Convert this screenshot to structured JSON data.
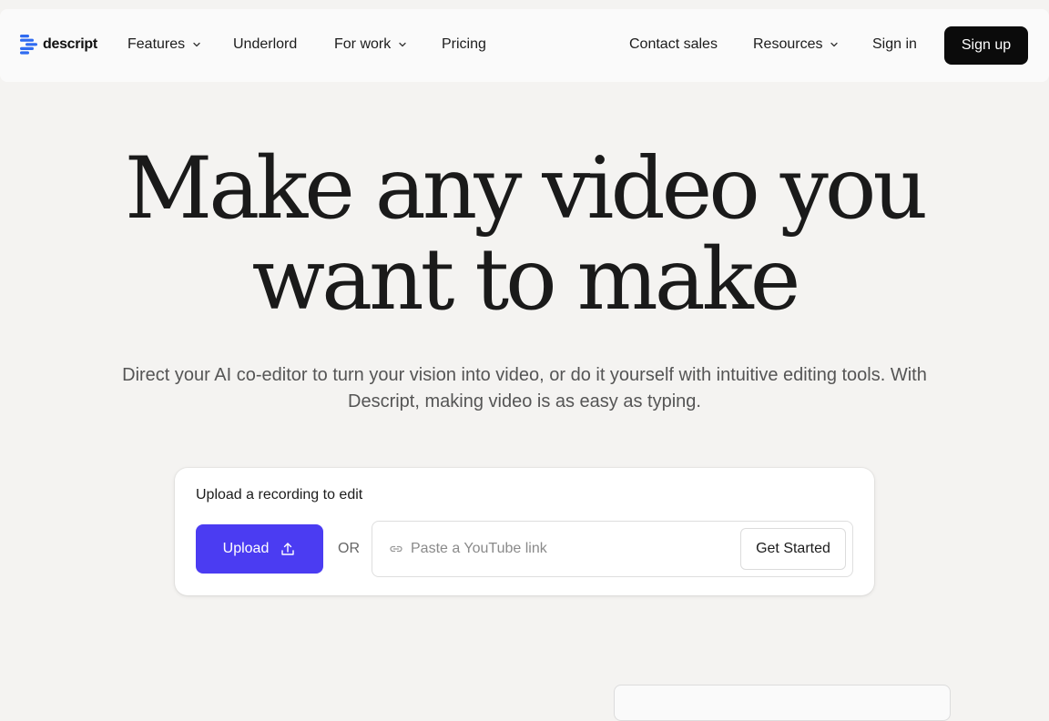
{
  "nav": {
    "brand": "descript",
    "features": "Features",
    "underlord": "Underlord",
    "for_work": "For work",
    "pricing": "Pricing",
    "contact_sales": "Contact sales",
    "resources": "Resources",
    "sign_in": "Sign in",
    "sign_up": "Sign up"
  },
  "hero": {
    "title_line1": "Make any video you",
    "title_line2": "want to make",
    "subtitle": "Direct your AI co-editor to turn your vision into video, or do it yourself with intuitive editing tools. With Descript, making video is as easy as typing."
  },
  "upload": {
    "title": "Upload a recording to edit",
    "upload_label": "Upload",
    "or_label": "OR",
    "youtube_placeholder": "Paste a YouTube link",
    "youtube_value": "",
    "get_started": "Get Started"
  },
  "colors": {
    "accent": "#4b3cf2",
    "brand_blue": "#2f6bf0",
    "background": "#f4f3f1",
    "dark_button": "#0b0b0b"
  },
  "icons": {
    "logo": "descript-logo-icon",
    "dropdown": "chevron-down-icon",
    "upload": "upload-icon",
    "link": "link-icon"
  }
}
